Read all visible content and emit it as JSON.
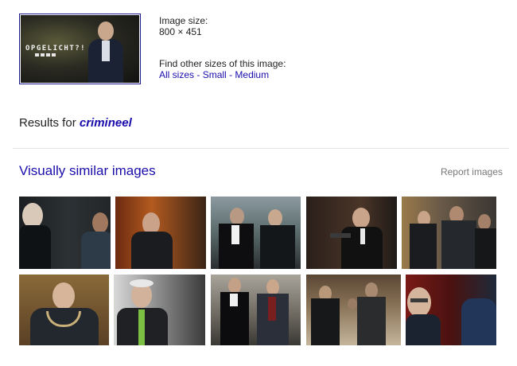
{
  "query_image": {
    "brand_text": "OPGELICHT?!"
  },
  "image_info": {
    "size_label": "Image size:",
    "size_value": "800 × 451",
    "other_sizes_label": "Find other sizes of this image:",
    "size_links": [
      "All sizes",
      "Small",
      "Medium"
    ],
    "separator": "-"
  },
  "results": {
    "prefix": "Results for",
    "query": "crimineel"
  },
  "similar": {
    "heading": "Visually similar images",
    "report_label": "Report images",
    "thumbnails": [
      {
        "name": "similar-image-1",
        "description": "bald man and man in suit, dark scene"
      },
      {
        "name": "similar-image-2",
        "description": "man in dark jacket, orange background"
      },
      {
        "name": "similar-image-3",
        "description": "lawyers in robes, courthouse"
      },
      {
        "name": "similar-image-4",
        "description": "man in suit aiming pistol"
      },
      {
        "name": "similar-image-5",
        "description": "men in dark coats, street"
      },
      {
        "name": "similar-image-6",
        "description": "mayor with chain of office"
      },
      {
        "name": "similar-image-7",
        "description": "man with green tie"
      },
      {
        "name": "similar-image-8",
        "description": "lawyer and man walking in hall"
      },
      {
        "name": "similar-image-9",
        "description": "courtroom with people standing"
      },
      {
        "name": "similar-image-10",
        "description": "bald man with glasses, red background"
      }
    ]
  },
  "colors": {
    "link": "#1a0dab",
    "muted": "#777777",
    "border": "#1a1a8c"
  }
}
